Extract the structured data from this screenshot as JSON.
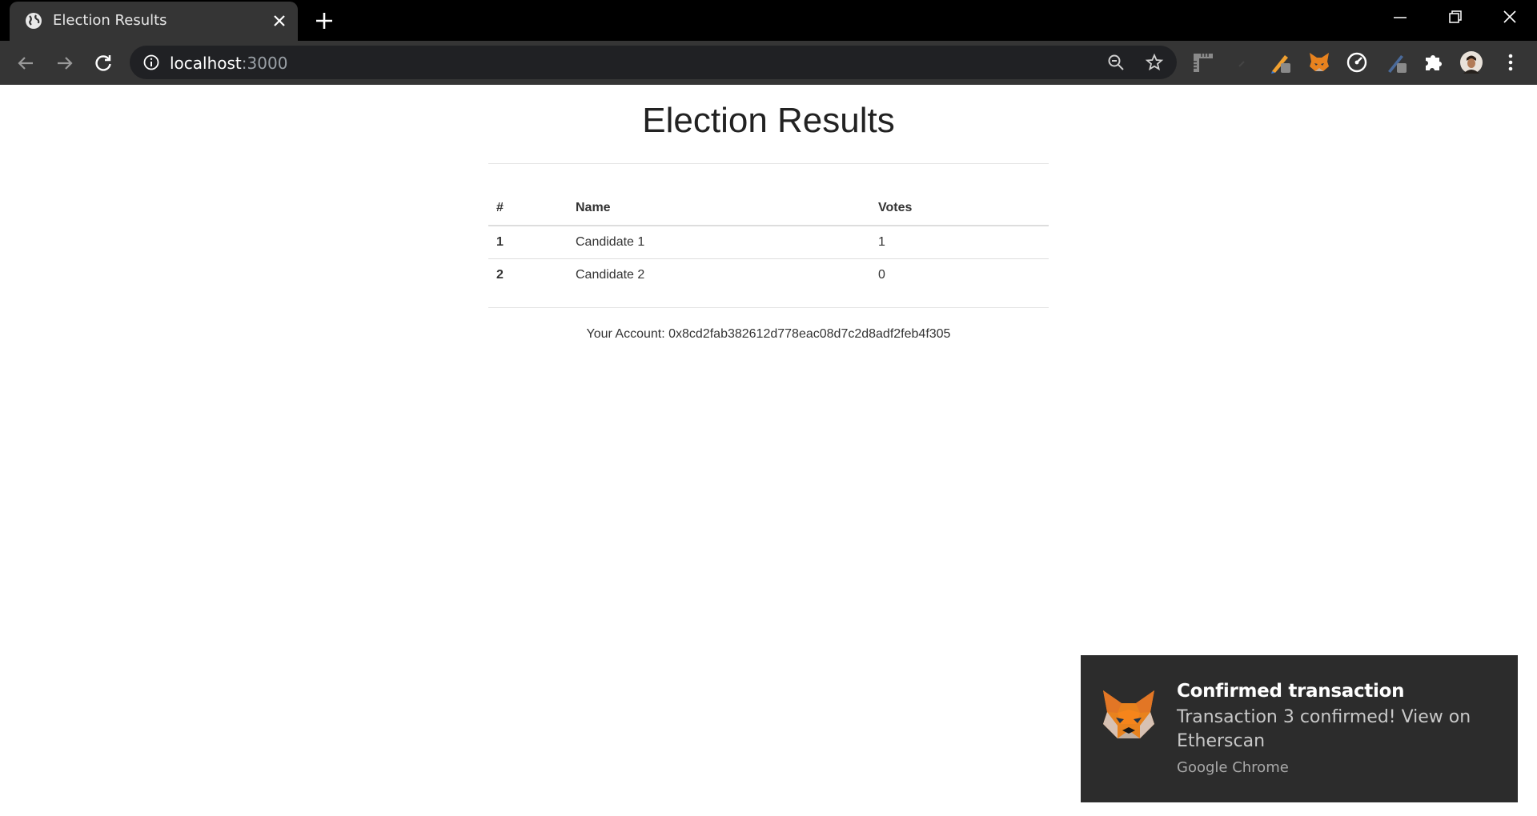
{
  "browser": {
    "tab_title": "Election Results",
    "url_host": "localhost",
    "url_port": ":3000",
    "icons": {
      "favicon": "globe-icon",
      "tab_close": "close-icon",
      "new_tab": "plus-icon",
      "back": "arrow-left-icon",
      "forward": "arrow-right-icon",
      "reload": "reload-icon",
      "site_info": "info-icon",
      "zoom": "zoom-out-icon",
      "bookmark": "star-icon",
      "extensions": [
        "ruler-icon",
        "blank-icon",
        "pen-icon",
        "fox-icon",
        "gauge-icon",
        "pen-alt-icon",
        "puzzle-icon",
        "profile-avatar",
        "more-vert-icon"
      ]
    }
  },
  "page": {
    "title": "Election Results",
    "table": {
      "headers": [
        "#",
        "Name",
        "Votes"
      ],
      "rows": [
        {
          "id": "1",
          "name": "Candidate 1",
          "votes": "1"
        },
        {
          "id": "2",
          "name": "Candidate 2",
          "votes": "0"
        }
      ]
    },
    "account_label": "Your Account: 0x8cd2fab382612d778eac08d7c2d8adf2feb4f305"
  },
  "notification": {
    "title": "Confirmed transaction",
    "body": "Transaction 3 confirmed! View on Etherscan",
    "source": "Google Chrome",
    "colors": {
      "background": "#2c2c2c",
      "fox_orange": "#e8821e"
    }
  }
}
